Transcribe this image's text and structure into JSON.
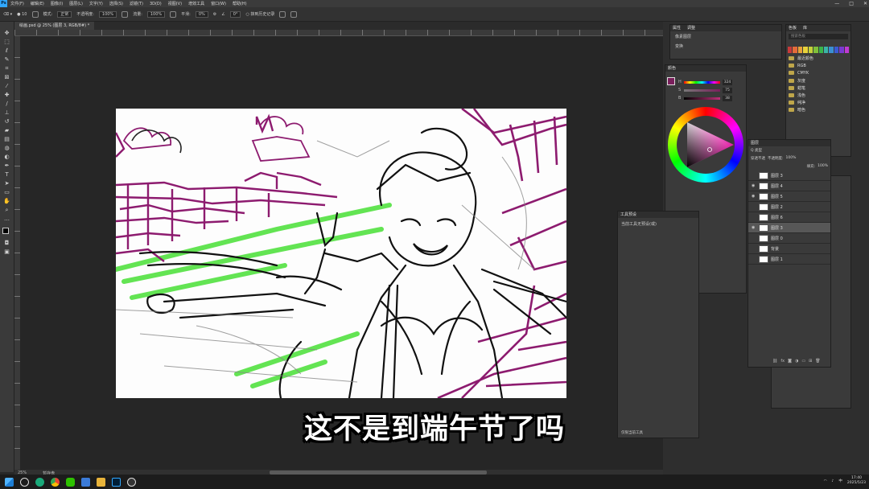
{
  "menubar": {
    "app_icon": "Ps",
    "items": [
      "文件(F)",
      "编辑(E)",
      "图像(I)",
      "图层(L)",
      "文字(Y)",
      "选择(S)",
      "滤镜(T)",
      "3D(D)",
      "视图(V)",
      "增效工具",
      "窗口(W)",
      "帮助(H)"
    ],
    "window_controls": [
      "—",
      "□",
      "✕"
    ]
  },
  "options_bar": {
    "brush_size": "10",
    "mode_label": "模式:",
    "mode_value": "正常",
    "opacity_label": "不透明度:",
    "opacity_value": "100%",
    "flow_label": "流量:",
    "flow_value": "100%",
    "smoothing_label": "平滑:",
    "smoothing_value": "0%",
    "angle_value": "0°",
    "erase_history_label": "抹到历史记录"
  },
  "document": {
    "tab_title": "绘画.psd @ 25% (图层 3, RGB/8#) *"
  },
  "toolbar": {
    "tools": [
      "move-icon",
      "marquee-icon",
      "lasso-icon",
      "quick-select-icon",
      "crop-icon",
      "frame-icon",
      "eyedropper-icon",
      "healing-icon",
      "brush-icon",
      "stamp-icon",
      "history-brush-icon",
      "eraser-icon",
      "gradient-icon",
      "blur-icon",
      "dodge-icon",
      "pen-icon",
      "type-icon",
      "path-select-icon",
      "shape-icon",
      "hand-icon",
      "zoom-icon",
      "more-icon"
    ]
  },
  "status": {
    "zoom": "25%",
    "info": "暂存盘"
  },
  "panels": {
    "properties": {
      "tabs": [
        "属性",
        "调整"
      ],
      "label": "像素图层",
      "sub": "变换"
    },
    "color": {
      "title": "颜色",
      "h": "H",
      "s": "S",
      "b": "B",
      "h_val": "324",
      "s_val": "75",
      "b_val": "38",
      "fg_color": "#7a1f5c"
    },
    "swatches": {
      "tabs": [
        "色板",
        "库"
      ],
      "search_placeholder": "搜索色板",
      "colors": [
        "#c83a3a",
        "#e56b3a",
        "#e8a13a",
        "#e8d23a",
        "#c5d23a",
        "#7fbf3a",
        "#3ab44a",
        "#3ab4a6",
        "#3a8fd2",
        "#3a5ad2",
        "#7a3ad2",
        "#c03ad2"
      ],
      "folders": [
        "最近颜色",
        "RGB",
        "CMYK",
        "灰度",
        "蜡笔",
        "浅色",
        "纯净",
        "暗色"
      ]
    },
    "layers": {
      "title": "图层",
      "kind_label": "Q 类型",
      "blend": "穿透不透",
      "opacity_label": "不透明度:",
      "opacity": "100%",
      "fill_label": "填充:",
      "fill": "100%",
      "items": [
        {
          "name": "图层 3",
          "visible": false,
          "selected": false
        },
        {
          "name": "图层 4",
          "visible": true,
          "selected": false
        },
        {
          "name": "图层 5",
          "visible": true,
          "selected": false
        },
        {
          "name": "图层 2",
          "visible": false,
          "selected": false
        },
        {
          "name": "图层 6",
          "visible": false,
          "selected": false
        },
        {
          "name": "图层 3",
          "visible": true,
          "selected": true
        },
        {
          "name": "图层 0",
          "visible": false,
          "selected": false
        },
        {
          "name": "背景",
          "visible": false,
          "selected": false
        },
        {
          "name": "图层 1",
          "visible": false,
          "selected": false
        }
      ]
    },
    "history": {
      "title": "工具预设",
      "body": "当前工具无预设(或)",
      "footer": "仅限当前工具"
    }
  },
  "subtitle": "这不是到端午节了吗",
  "taskbar": {
    "apps": [
      "start-icon",
      "search-icon",
      "edge-icon",
      "chrome-icon",
      "wechat-icon",
      "explorer-icon",
      "folder-icon",
      "photoshop-icon",
      "obs-icon"
    ],
    "lang": "中",
    "time": "17:40",
    "date": "2025/5/23"
  }
}
